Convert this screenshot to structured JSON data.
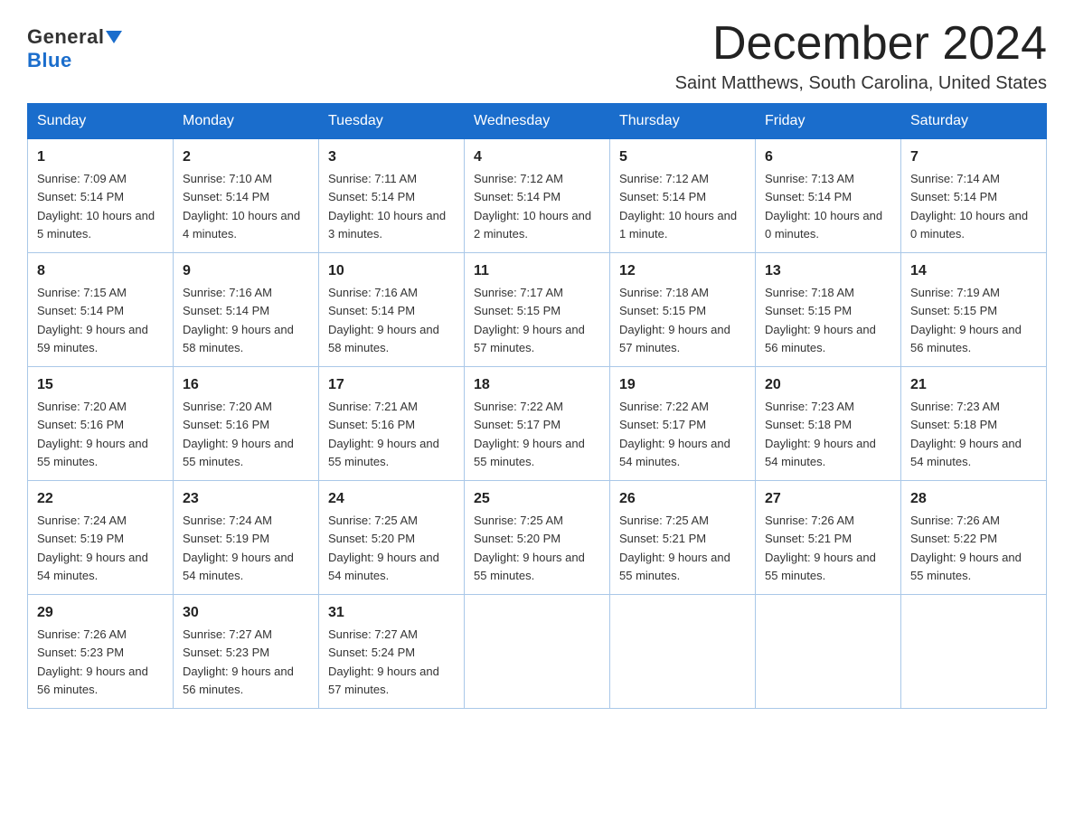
{
  "logo": {
    "general": "General",
    "blue": "Blue"
  },
  "title": "December 2024",
  "subtitle": "Saint Matthews, South Carolina, United States",
  "days_of_week": [
    "Sunday",
    "Monday",
    "Tuesday",
    "Wednesday",
    "Thursday",
    "Friday",
    "Saturday"
  ],
  "weeks": [
    [
      {
        "day": "1",
        "sunrise": "7:09 AM",
        "sunset": "5:14 PM",
        "daylight": "10 hours and 5 minutes."
      },
      {
        "day": "2",
        "sunrise": "7:10 AM",
        "sunset": "5:14 PM",
        "daylight": "10 hours and 4 minutes."
      },
      {
        "day": "3",
        "sunrise": "7:11 AM",
        "sunset": "5:14 PM",
        "daylight": "10 hours and 3 minutes."
      },
      {
        "day": "4",
        "sunrise": "7:12 AM",
        "sunset": "5:14 PM",
        "daylight": "10 hours and 2 minutes."
      },
      {
        "day": "5",
        "sunrise": "7:12 AM",
        "sunset": "5:14 PM",
        "daylight": "10 hours and 1 minute."
      },
      {
        "day": "6",
        "sunrise": "7:13 AM",
        "sunset": "5:14 PM",
        "daylight": "10 hours and 0 minutes."
      },
      {
        "day": "7",
        "sunrise": "7:14 AM",
        "sunset": "5:14 PM",
        "daylight": "10 hours and 0 minutes."
      }
    ],
    [
      {
        "day": "8",
        "sunrise": "7:15 AM",
        "sunset": "5:14 PM",
        "daylight": "9 hours and 59 minutes."
      },
      {
        "day": "9",
        "sunrise": "7:16 AM",
        "sunset": "5:14 PM",
        "daylight": "9 hours and 58 minutes."
      },
      {
        "day": "10",
        "sunrise": "7:16 AM",
        "sunset": "5:14 PM",
        "daylight": "9 hours and 58 minutes."
      },
      {
        "day": "11",
        "sunrise": "7:17 AM",
        "sunset": "5:15 PM",
        "daylight": "9 hours and 57 minutes."
      },
      {
        "day": "12",
        "sunrise": "7:18 AM",
        "sunset": "5:15 PM",
        "daylight": "9 hours and 57 minutes."
      },
      {
        "day": "13",
        "sunrise": "7:18 AM",
        "sunset": "5:15 PM",
        "daylight": "9 hours and 56 minutes."
      },
      {
        "day": "14",
        "sunrise": "7:19 AM",
        "sunset": "5:15 PM",
        "daylight": "9 hours and 56 minutes."
      }
    ],
    [
      {
        "day": "15",
        "sunrise": "7:20 AM",
        "sunset": "5:16 PM",
        "daylight": "9 hours and 55 minutes."
      },
      {
        "day": "16",
        "sunrise": "7:20 AM",
        "sunset": "5:16 PM",
        "daylight": "9 hours and 55 minutes."
      },
      {
        "day": "17",
        "sunrise": "7:21 AM",
        "sunset": "5:16 PM",
        "daylight": "9 hours and 55 minutes."
      },
      {
        "day": "18",
        "sunrise": "7:22 AM",
        "sunset": "5:17 PM",
        "daylight": "9 hours and 55 minutes."
      },
      {
        "day": "19",
        "sunrise": "7:22 AM",
        "sunset": "5:17 PM",
        "daylight": "9 hours and 54 minutes."
      },
      {
        "day": "20",
        "sunrise": "7:23 AM",
        "sunset": "5:18 PM",
        "daylight": "9 hours and 54 minutes."
      },
      {
        "day": "21",
        "sunrise": "7:23 AM",
        "sunset": "5:18 PM",
        "daylight": "9 hours and 54 minutes."
      }
    ],
    [
      {
        "day": "22",
        "sunrise": "7:24 AM",
        "sunset": "5:19 PM",
        "daylight": "9 hours and 54 minutes."
      },
      {
        "day": "23",
        "sunrise": "7:24 AM",
        "sunset": "5:19 PM",
        "daylight": "9 hours and 54 minutes."
      },
      {
        "day": "24",
        "sunrise": "7:25 AM",
        "sunset": "5:20 PM",
        "daylight": "9 hours and 54 minutes."
      },
      {
        "day": "25",
        "sunrise": "7:25 AM",
        "sunset": "5:20 PM",
        "daylight": "9 hours and 55 minutes."
      },
      {
        "day": "26",
        "sunrise": "7:25 AM",
        "sunset": "5:21 PM",
        "daylight": "9 hours and 55 minutes."
      },
      {
        "day": "27",
        "sunrise": "7:26 AM",
        "sunset": "5:21 PM",
        "daylight": "9 hours and 55 minutes."
      },
      {
        "day": "28",
        "sunrise": "7:26 AM",
        "sunset": "5:22 PM",
        "daylight": "9 hours and 55 minutes."
      }
    ],
    [
      {
        "day": "29",
        "sunrise": "7:26 AM",
        "sunset": "5:23 PM",
        "daylight": "9 hours and 56 minutes."
      },
      {
        "day": "30",
        "sunrise": "7:27 AM",
        "sunset": "5:23 PM",
        "daylight": "9 hours and 56 minutes."
      },
      {
        "day": "31",
        "sunrise": "7:27 AM",
        "sunset": "5:24 PM",
        "daylight": "9 hours and 57 minutes."
      },
      null,
      null,
      null,
      null
    ]
  ]
}
